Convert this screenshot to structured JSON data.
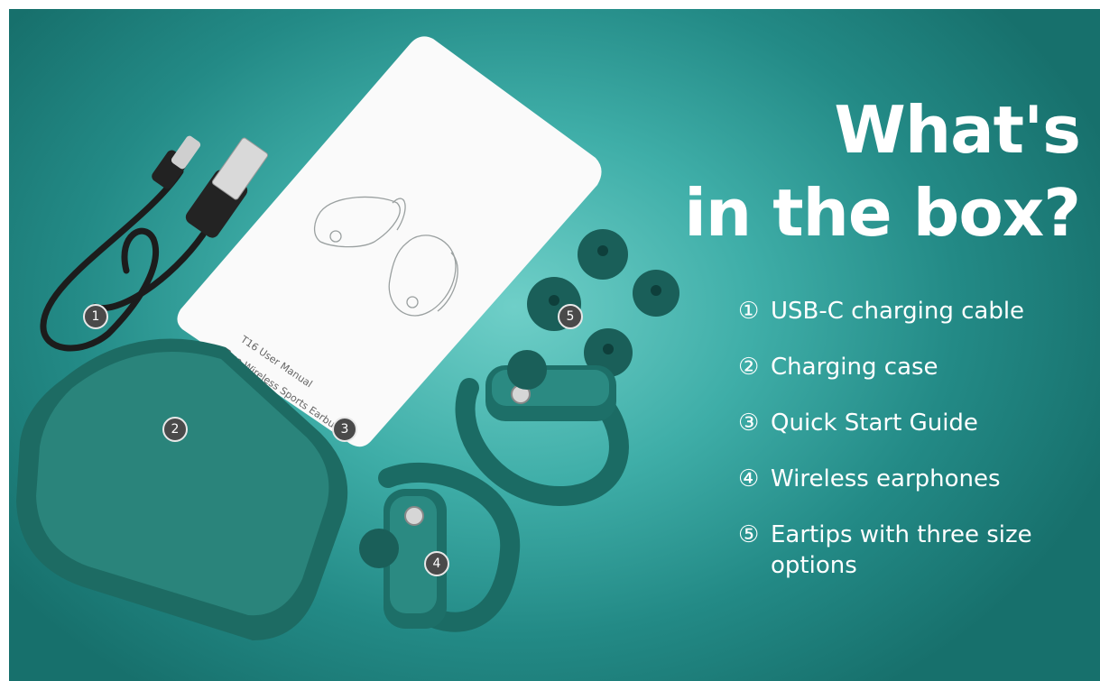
{
  "headline": {
    "line1": "What's",
    "line2": "in the box?"
  },
  "items": [
    {
      "num": "①",
      "text": "USB-C charging cable"
    },
    {
      "num": "②",
      "text": "Charging case"
    },
    {
      "num": "③",
      "text": "Quick Start Guide"
    },
    {
      "num": "④",
      "text": "Wireless earphones"
    },
    {
      "num": "⑤",
      "text": "Eartips with three size options"
    }
  ],
  "manual": {
    "line1": "T16 User Manual",
    "line2": "True Wireless Sports Earbuds"
  },
  "badges": [
    "1",
    "2",
    "3",
    "4",
    "5"
  ],
  "colors": {
    "background": "#2fa39e",
    "product": "#1e6f68",
    "text": "#ffffff"
  }
}
